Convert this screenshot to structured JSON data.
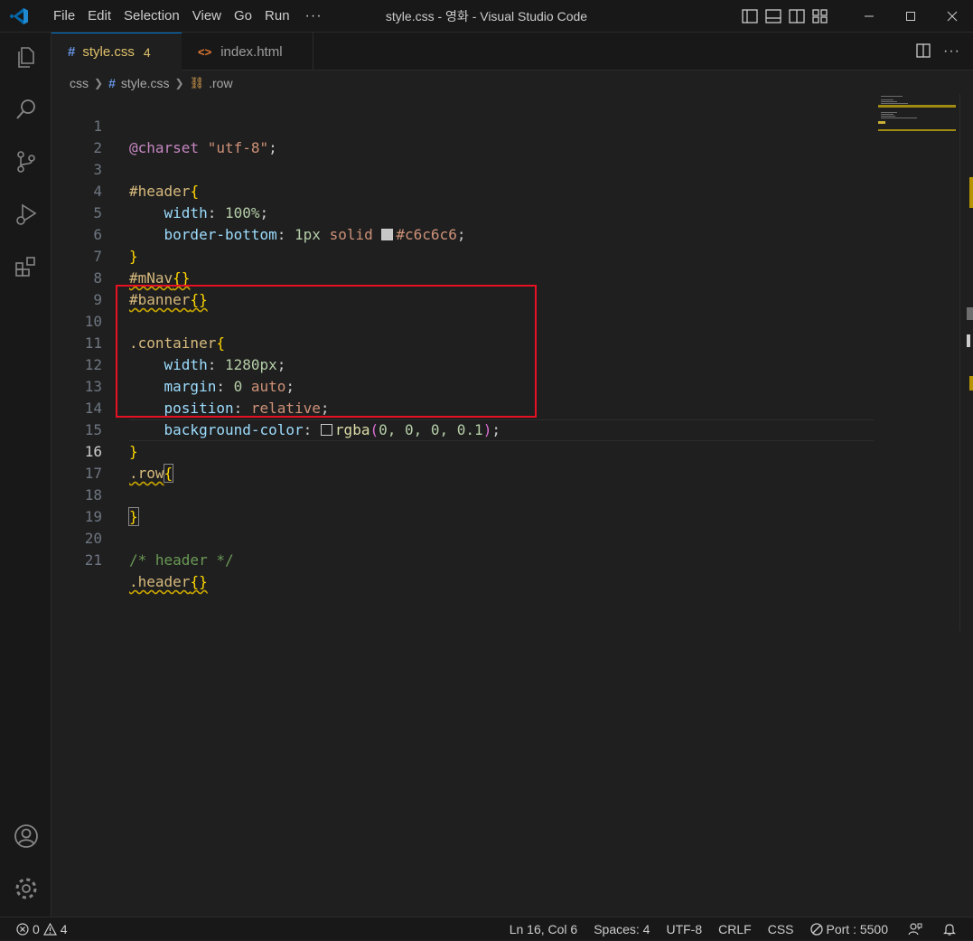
{
  "titlebar": {
    "menu": [
      "File",
      "Edit",
      "Selection",
      "View",
      "Go",
      "Run"
    ],
    "more": "···",
    "title": "style.css - 영화 - Visual Studio Code"
  },
  "tabs": [
    {
      "label": "style.css",
      "badge": "4",
      "icon": "css-hash-icon",
      "active": true
    },
    {
      "label": "index.html",
      "icon": "html-code-icon",
      "active": false
    }
  ],
  "breadcrumb": {
    "folder": "css",
    "file": "style.css",
    "symbol": ".row"
  },
  "editor": {
    "line_numbers": [
      "1",
      "2",
      "3",
      "4",
      "5",
      "6",
      "7",
      "8",
      "9",
      "10",
      "11",
      "12",
      "13",
      "14",
      "15",
      "16",
      "17",
      "18",
      "19",
      "20",
      "21"
    ],
    "current_line": "16",
    "code": {
      "l1_kw": "@charset",
      "l1_str": "\"utf-8\"",
      "l1_end": ";",
      "l3_sel": "#header",
      "l4_prop": "width",
      "l4_val": "100%",
      "l5_prop": "border-bottom",
      "l5_num": "1px",
      "l5_val": "solid",
      "l5_color": "#c6c6c6",
      "l7_sel": "#mNav",
      "l8_sel": "#banner",
      "l10_sel": ".container",
      "l11_prop": "width",
      "l11_val": "1280px",
      "l12_prop": "margin",
      "l12_num": "0",
      "l12_val": "auto",
      "l13_prop": "position",
      "l13_val": "relative",
      "l14_prop": "background-color",
      "l14_fn": "rgba",
      "l14_args": "0, 0, 0, 0.1",
      "l16_sel": ".row",
      "l20_comment": "/* header */",
      "l21_sel": ".header"
    }
  },
  "statusbar": {
    "errors": "0",
    "warnings": "4",
    "position": "Ln 16, Col 6",
    "spaces": "Spaces: 4",
    "encoding": "UTF-8",
    "eol": "CRLF",
    "language": "CSS",
    "port": "Port : 5500"
  },
  "colors": {
    "accent": "#0078d4",
    "highlight_box": "#e81123",
    "warning": "#cca700"
  }
}
